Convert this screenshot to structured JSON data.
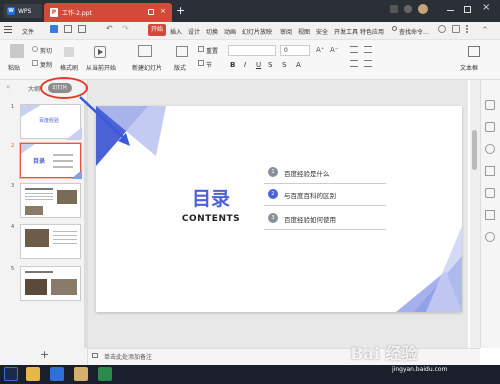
{
  "titlebar": {
    "app": "WPS",
    "doc_tab": "工作-2.ppt",
    "new_tab": "+"
  },
  "menu": {
    "file": "文件",
    "items": [
      "开始",
      "插入",
      "设计",
      "切换",
      "动画",
      "幻灯片放映",
      "审阅",
      "视图",
      "安全",
      "开发工具",
      "特色应用"
    ],
    "search": "查找命令..."
  },
  "ribbon": {
    "paste": "粘贴",
    "cut": "剪切",
    "copy": "复制",
    "format_painter": "格式刷",
    "from_current": "从当前开始",
    "new_slide": "新建幻灯片",
    "layout": "版式",
    "reset": "重置",
    "section": "节",
    "font_size": "0",
    "textbox": "文本框"
  },
  "left_panel": {
    "tab_outline": "大纲",
    "tab_slides": "幻灯片",
    "thumbs": [
      {
        "num": "1",
        "text": "百度经验"
      },
      {
        "num": "2",
        "text": "目录"
      },
      {
        "num": "3",
        "text": ""
      },
      {
        "num": "4",
        "text": ""
      },
      {
        "num": "5",
        "text": ""
      }
    ],
    "add": "+"
  },
  "slide": {
    "title": "目录",
    "subtitle": "CONTENTS",
    "items": [
      {
        "num": "1",
        "text": "百度经验是什么"
      },
      {
        "num": "2",
        "text": "与百度百科的区别"
      },
      {
        "num": "3",
        "text": "百度经验如何使用"
      }
    ]
  },
  "notes": {
    "text": "单击此处添加备注"
  },
  "watermark": {
    "main": "Bai 经验",
    "url": "jingyan.baidu.com"
  },
  "colors": {
    "accent": "#d44a3a",
    "slide_blue": "#4b62d6",
    "annotation": "#e23b2c"
  }
}
